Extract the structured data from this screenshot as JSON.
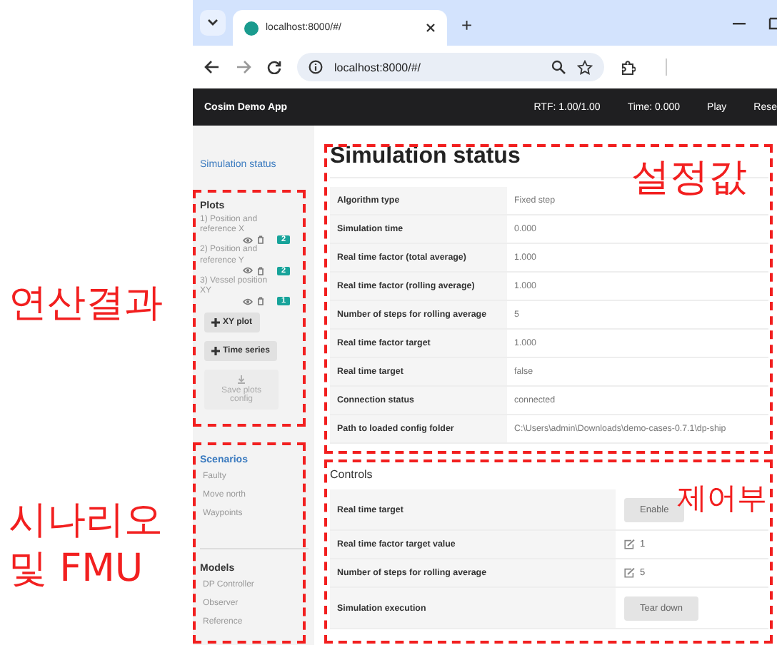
{
  "browser": {
    "tab": {
      "title": "localhost:8000/#/",
      "selected": true
    },
    "new_tab": "+",
    "address": "localhost:8000/#/"
  },
  "app_bar": {
    "title": "Cosim Demo App",
    "items": [
      "RTF: 1.00/1.00",
      "Time: 0.000",
      "Play",
      "Rese"
    ]
  },
  "sidebar": {
    "link": "Simulation status",
    "plots": {
      "heading": "Plots",
      "items": [
        {
          "label": "1) Position and reference X",
          "count": "2"
        },
        {
          "label": "2) Position and reference Y",
          "count": "2"
        },
        {
          "label": "3) Vessel position XY",
          "count": "1"
        }
      ],
      "buttons": [
        {
          "label": "XY plot",
          "kind": "add",
          "disabled": false
        },
        {
          "label": "Time series",
          "kind": "add",
          "disabled": false
        },
        {
          "label": "Save plots config",
          "kind": "save",
          "disabled": true
        }
      ]
    },
    "scenarios": {
      "heading": "Scenarios",
      "items": [
        "Faulty",
        "Move north",
        "Waypoints"
      ]
    },
    "models": {
      "heading": "Models",
      "items": [
        "DP Controller",
        "Observer",
        "Reference"
      ]
    }
  },
  "status": {
    "title": "Simulation status",
    "rows": [
      {
        "label": "Algorithm type",
        "value": "Fixed step"
      },
      {
        "label": "Simulation time",
        "value": "0.000"
      },
      {
        "label": "Real time factor (total average)",
        "value": "1.000"
      },
      {
        "label": "Real time factor (rolling average)",
        "value": "1.000"
      },
      {
        "label": "Number of steps for rolling average",
        "value": "5"
      },
      {
        "label": "Real time factor target",
        "value": "1.000"
      },
      {
        "label": "Real time target",
        "value": "false"
      },
      {
        "label": "Connection status",
        "value": "connected"
      },
      {
        "label": "Path to loaded config folder",
        "value": "C:\\Users\\admin\\Downloads\\demo-cases-0.7.1\\dp-ship"
      }
    ]
  },
  "controls": {
    "title": "Controls",
    "rows": [
      {
        "label": "Real time target",
        "kind": "button",
        "value": "Enable"
      },
      {
        "label": "Real time factor target value",
        "kind": "edit",
        "value": "1"
      },
      {
        "label": "Number of steps for rolling average",
        "kind": "edit",
        "value": "5"
      },
      {
        "label": "Simulation execution",
        "kind": "button",
        "value": "Tear down"
      }
    ]
  },
  "annotations": [
    "연산결과",
    "시나리오 및 FMU",
    "설정값",
    "제어부"
  ]
}
